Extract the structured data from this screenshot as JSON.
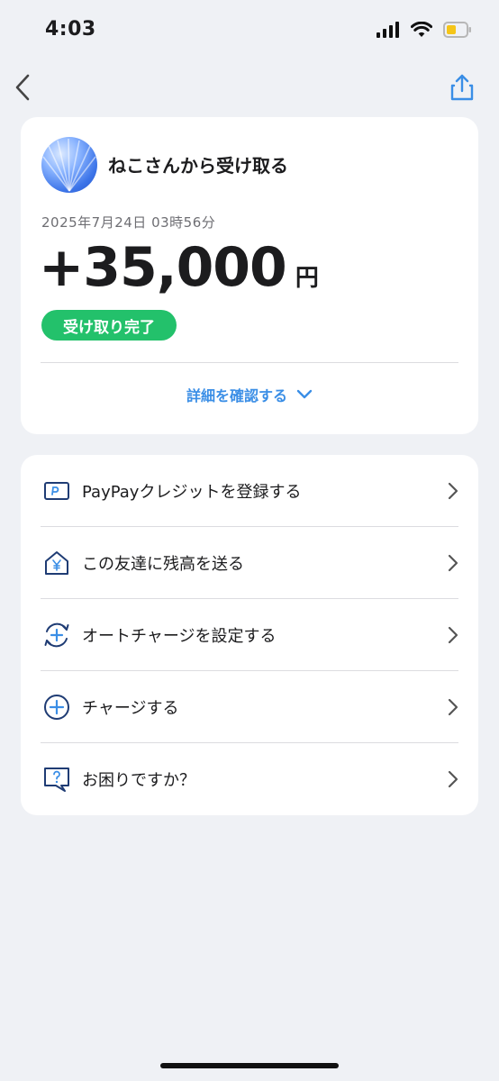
{
  "status_bar": {
    "time": "4:03"
  },
  "nav": {
    "back_icon": "chevron-left-icon",
    "share_icon": "share-icon"
  },
  "transaction": {
    "title": "ねこさんから受け取る",
    "datetime": "2025年7月24日 03時56分",
    "amount": "+35,000",
    "currency": "円",
    "status": "受け取り完了",
    "details_label": "詳細を確認する"
  },
  "menu": {
    "items": [
      {
        "label": "PayPayクレジットを登録する",
        "icon": "credit-card-icon"
      },
      {
        "label": "この友達に残高を送る",
        "icon": "yen-house-icon"
      },
      {
        "label": "オートチャージを設定する",
        "icon": "auto-charge-icon"
      },
      {
        "label": "チャージする",
        "icon": "plus-circle-icon"
      },
      {
        "label": "お困りですか？",
        "icon": "help-question-icon"
      }
    ]
  },
  "colors": {
    "accent": "#3a8ee6",
    "success": "#23c16b",
    "icon_navy": "#1f3c74",
    "background": "#eff1f5"
  }
}
